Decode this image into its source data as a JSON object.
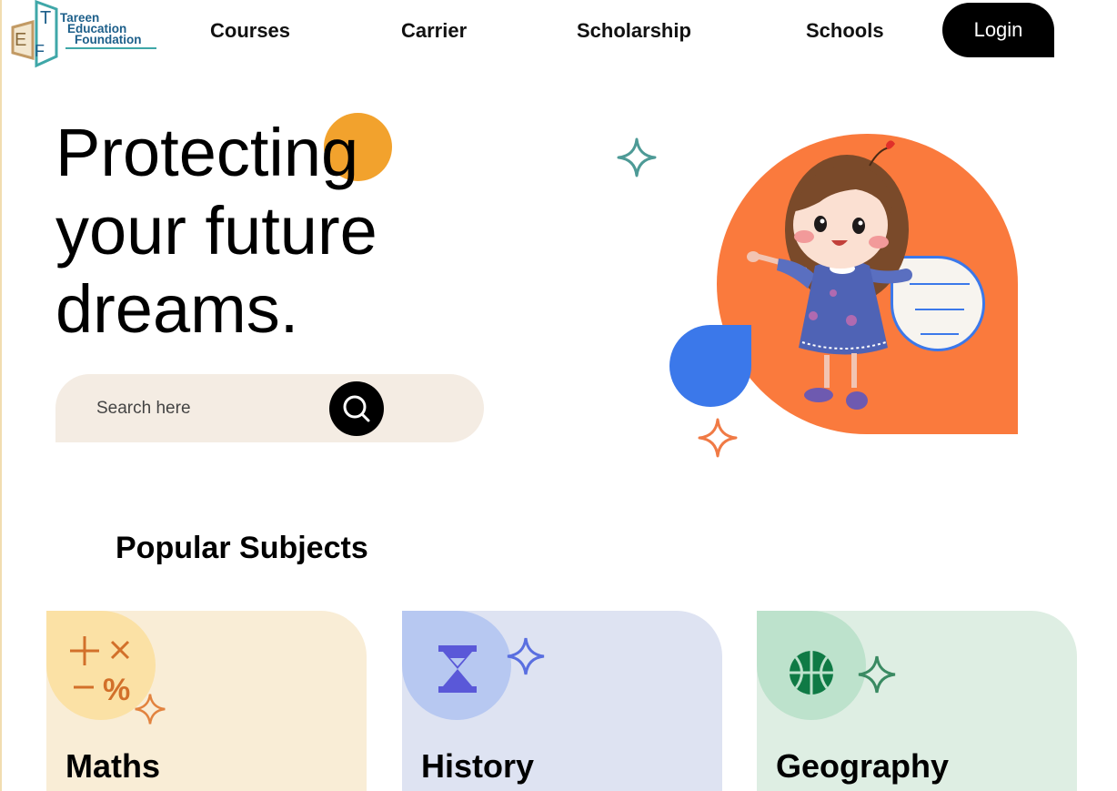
{
  "brand": {
    "name_lines": [
      "Tareen",
      "Education",
      "Foundation"
    ],
    "mark_letters": [
      "E",
      "T",
      "F"
    ]
  },
  "nav": {
    "items": [
      {
        "label": "Courses"
      },
      {
        "label": "Carrier"
      },
      {
        "label": "Scholarship"
      },
      {
        "label": "Schools"
      }
    ],
    "login_label": "Login"
  },
  "hero": {
    "title_lines": [
      "Protecting",
      "your future",
      "dreams."
    ],
    "search": {
      "placeholder": "Search here",
      "value": ""
    }
  },
  "subjects": {
    "title": "Popular Subjects",
    "cards": [
      {
        "label": "Maths",
        "icon": "math-symbols-icon"
      },
      {
        "label": "History",
        "icon": "hourglass-icon"
      },
      {
        "label": "Geography",
        "icon": "basketball-globe-icon"
      }
    ]
  },
  "colors": {
    "accent_orange": "#fa7a3d",
    "accent_yellow": "#f2a22d",
    "accent_blue": "#3b78ea",
    "search_bg": "#f4ece3",
    "maths_bg": "#f9edd6",
    "history_bg": "#dee3f2",
    "geography_bg": "#deeee3"
  }
}
